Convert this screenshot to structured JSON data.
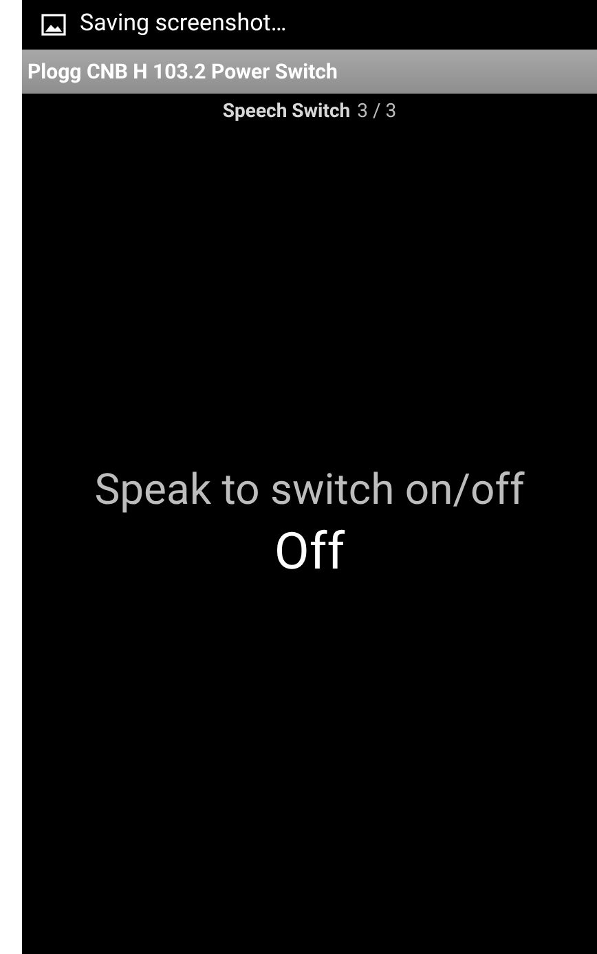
{
  "status_bar": {
    "notification": "Saving screenshot…"
  },
  "action_bar": {
    "title": "Plogg CNB H 103.2 Power Switch"
  },
  "subtitle": {
    "name": "Speech Switch",
    "counter": "3 / 3"
  },
  "prompt": "Speak to switch on/off",
  "state": {
    "label": "Off",
    "on": false
  }
}
